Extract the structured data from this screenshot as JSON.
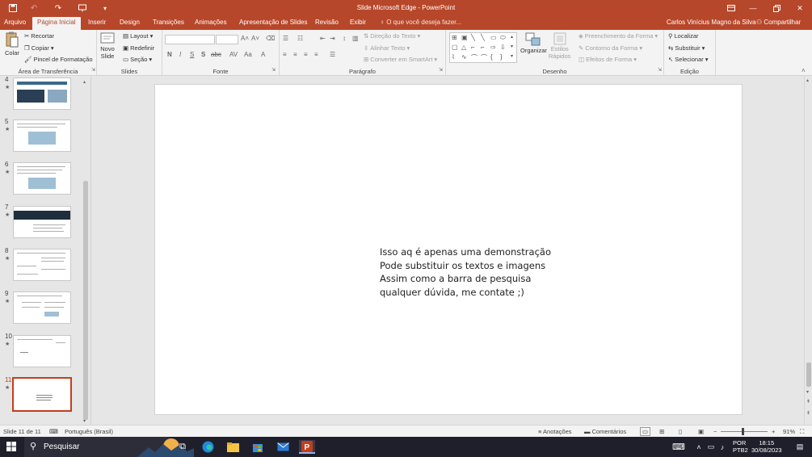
{
  "titlebar": {
    "title": "Slide Microsoft Edge  -  PowerPoint",
    "colors": {
      "accent": "#b7472a"
    }
  },
  "tabs": [
    {
      "label": "Arquivo",
      "active": false
    },
    {
      "label": "Página Inicial",
      "active": true
    },
    {
      "label": "Inserir",
      "active": false
    },
    {
      "label": "Design",
      "active": false
    },
    {
      "label": "Transições",
      "active": false
    },
    {
      "label": "Animações",
      "active": false
    },
    {
      "label": "Apresentação de Slides",
      "active": false
    },
    {
      "label": "Revisão",
      "active": false
    },
    {
      "label": "Exibir",
      "active": false
    }
  ],
  "tellme": "O que você deseja fazer...",
  "user": "Carlos Vinícius Magno da Silva",
  "share": "Compartilhar",
  "ribbon": {
    "clipboard": {
      "label": "Área de Transferência",
      "paste": "Colar",
      "cut": "Recortar",
      "copy": "Copiar",
      "format_painter": "Pincel de Formatação"
    },
    "slides": {
      "label": "Slides",
      "new_slide_1": "Novo",
      "new_slide_2": "Slide",
      "layout": "Layout",
      "reset": "Redefinir",
      "section": "Seção"
    },
    "font": {
      "label": "Fonte",
      "buttons": [
        "N",
        "I",
        "S",
        "S",
        "AV",
        "Aa",
        "A"
      ]
    },
    "paragraph": {
      "label": "Parágrafo",
      "text_direction": "Direção do Texto",
      "align_text": "Alinhar Texto",
      "smartart": "Converter em SmartArt"
    },
    "drawing": {
      "label": "Desenho",
      "arrange": "Organizar",
      "quick_styles_1": "Estilos",
      "quick_styles_2": "Rápidos",
      "fill": "Preenchimento da Forma",
      "outline": "Contorno da Forma",
      "effects": "Efeitos de Forma"
    },
    "editing": {
      "label": "Edição",
      "find": "Localizar",
      "replace": "Substituir",
      "select": "Selecionar"
    }
  },
  "thumbnails": [
    {
      "num": "4",
      "star": "★"
    },
    {
      "num": "5",
      "star": "★"
    },
    {
      "num": "6",
      "star": "★"
    },
    {
      "num": "7",
      "star": "★"
    },
    {
      "num": "8",
      "star": "★"
    },
    {
      "num": "9",
      "star": "★"
    },
    {
      "num": "10",
      "star": "★"
    },
    {
      "num": "11",
      "star": "★",
      "selected": true
    }
  ],
  "slide": {
    "lines": [
      "Isso aq é apenas uma demonstração",
      "Pode substituir os textos e imagens",
      "Assim como a barra de pesquisa",
      "qualquer dúvida, me contate ;)"
    ]
  },
  "status": {
    "slide_counter": "Slide 11 de 11",
    "language": "Português (Brasil)",
    "notes": "Anotações",
    "comments": "Comentários",
    "zoom": "91%"
  },
  "taskbar": {
    "search": "Pesquisar",
    "lang_1": "POR",
    "lang_2": "PTB2",
    "time": "18:15",
    "date": "30/08/2023"
  }
}
